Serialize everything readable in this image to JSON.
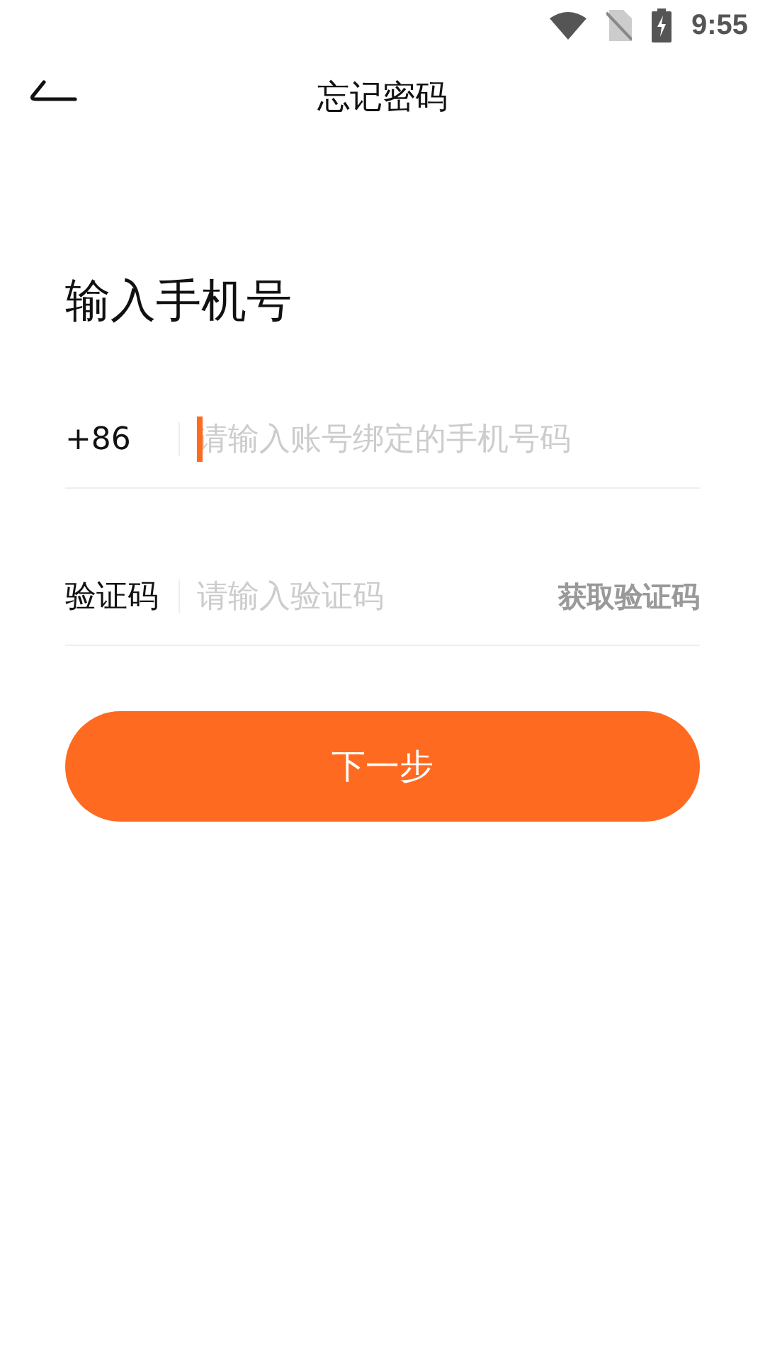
{
  "status_bar": {
    "time": "9:55"
  },
  "header": {
    "title": "忘记密码"
  },
  "heading": "输入手机号",
  "phone_field": {
    "prefix": "+86",
    "placeholder": "请输入账号绑定的手机号码",
    "focused": true
  },
  "code_field": {
    "label": "验证码",
    "placeholder": "请输入验证码",
    "action": "获取验证码"
  },
  "next_button": {
    "label": "下一步"
  }
}
